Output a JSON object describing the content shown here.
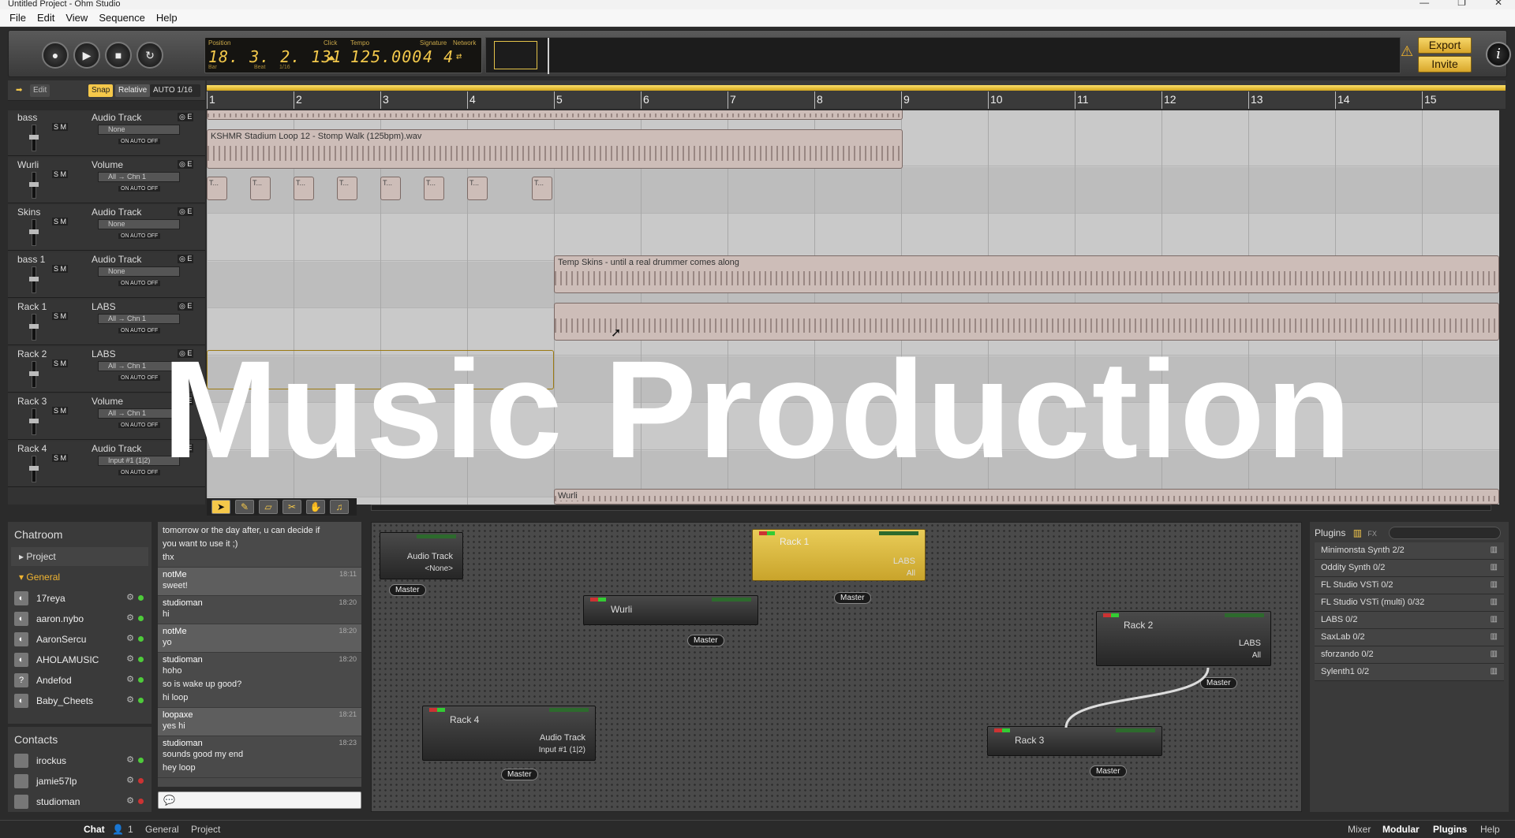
{
  "window": {
    "title": "Untitled Project - Ohm Studio",
    "controls": [
      "—",
      "❐",
      "✕"
    ]
  },
  "menu": [
    "File",
    "Edit",
    "View",
    "Sequence",
    "Help"
  ],
  "transport": {
    "position_label": "Position",
    "position": "18. 3. 2. 131",
    "bar_label": "Bar",
    "beat_label": "Beat",
    "sixteenth_label": "1/16",
    "click_label": "Click",
    "tempo_label": "Tempo",
    "tempo": "125.000",
    "signature_label": "Signature",
    "signature": "4 4",
    "network_label": "Network",
    "export": "Export",
    "invite": "Invite",
    "info": "i"
  },
  "edit_toolbar": {
    "edit": "Edit",
    "snap": "Snap",
    "relative": "Relative",
    "auto": "AUTO 1/16"
  },
  "ruler": [
    "1",
    "2",
    "3",
    "4",
    "5",
    "6",
    "7",
    "8",
    "9",
    "10",
    "11",
    "12",
    "13",
    "14",
    "15"
  ],
  "tracks": [
    {
      "name": "bass",
      "type": "Audio Track",
      "input": "None"
    },
    {
      "name": "Wurli",
      "type": "Volume",
      "input": "All → Chn 1"
    },
    {
      "name": "Skins",
      "type": "Audio Track",
      "input": "None"
    },
    {
      "name": "bass 1",
      "type": "Audio Track",
      "input": "None"
    },
    {
      "name": "Rack 1",
      "type": "LABS",
      "input": "All → Chn 1"
    },
    {
      "name": "Rack 2",
      "type": "LABS",
      "input": "All → Chn 1"
    },
    {
      "name": "Rack 3",
      "type": "Volume",
      "input": "All → Chn 1"
    },
    {
      "name": "Rack 4",
      "type": "Audio Track",
      "input": "Input #1 (1|2)"
    }
  ],
  "track_controls": {
    "sm": "S M",
    "onauto": "ON AUTO OFF",
    "hdr": "◎ E"
  },
  "clips": {
    "bass": "KSHMR Stadium Loop 12 - Stomp Walk (125bpm).wav",
    "mini": "T...",
    "skins": "Temp  Skins - until a real drummer comes along",
    "wurli": "Wurli"
  },
  "overlay_title": "Music Production",
  "chatroom": {
    "title": "Chatroom",
    "project": "Project",
    "general": "General",
    "users": [
      {
        "name": "17reya",
        "av": "◐"
      },
      {
        "name": "aaron.nybo",
        "av": "◐"
      },
      {
        "name": "AaronSercu",
        "av": "◐"
      },
      {
        "name": "AHOLAMUSIC",
        "av": "◐"
      },
      {
        "name": "Andefod",
        "av": "?"
      },
      {
        "name": "Baby_Cheets",
        "av": "◐"
      }
    ]
  },
  "contacts": {
    "title": "Contacts",
    "users": [
      {
        "name": "irockus",
        "status": "green"
      },
      {
        "name": "jamie57lp",
        "status": "red"
      },
      {
        "name": "studioman",
        "status": "red"
      }
    ]
  },
  "chat": [
    {
      "who": "",
      "time": "",
      "lines": [
        "tomorrow or the day after, u can decide if",
        "you want to use it ;)",
        "thx"
      ],
      "hl": false
    },
    {
      "who": "notMe",
      "time": "18:11",
      "lines": [
        "sweet!"
      ],
      "hl": true
    },
    {
      "who": "studioman",
      "time": "18:20",
      "lines": [
        "hi"
      ],
      "hl": false
    },
    {
      "who": "notMe",
      "time": "18:20",
      "lines": [
        "yo"
      ],
      "hl": true
    },
    {
      "who": "studioman",
      "time": "18:20",
      "lines": [
        "hoho",
        "so is wake up good?",
        "hi loop"
      ],
      "hl": false
    },
    {
      "who": "loopaxe",
      "time": "18:21",
      "lines": [
        "yes hi"
      ],
      "hl": true
    },
    {
      "who": "studioman",
      "time": "18:23",
      "lines": [
        "sounds good my end",
        "hey loop"
      ],
      "hl": false
    }
  ],
  "modular": {
    "audio_track": "Audio Track",
    "none": "<None>",
    "rack1": "Rack 1",
    "labs": "LABS",
    "all": "All",
    "wurli": "Wurli",
    "rack2": "Rack 2",
    "rack3": "Rack 3",
    "rack4": "Rack 4",
    "input1": "Input #1 (1|2)",
    "master": "Master"
  },
  "plugins": {
    "title": "Plugins",
    "items": [
      "Minimonsta Synth 2/2",
      "Oddity Synth 0/2",
      "FL Studio VSTi 0/2",
      "FL Studio VSTi (multi) 0/32",
      "LABS 0/2",
      "SaxLab 0/2",
      "sforzando 0/2",
      "Sylenth1 0/2"
    ]
  },
  "status": {
    "chat": "Chat",
    "people": "1",
    "general": "General",
    "project": "Project",
    "mixer": "Mixer",
    "modular": "Modular",
    "plugins": "Plugins",
    "help": "Help"
  },
  "colors": {
    "accent": "#f2c84b",
    "clip": "#cdbdb8",
    "online": "#4ecb3a"
  }
}
